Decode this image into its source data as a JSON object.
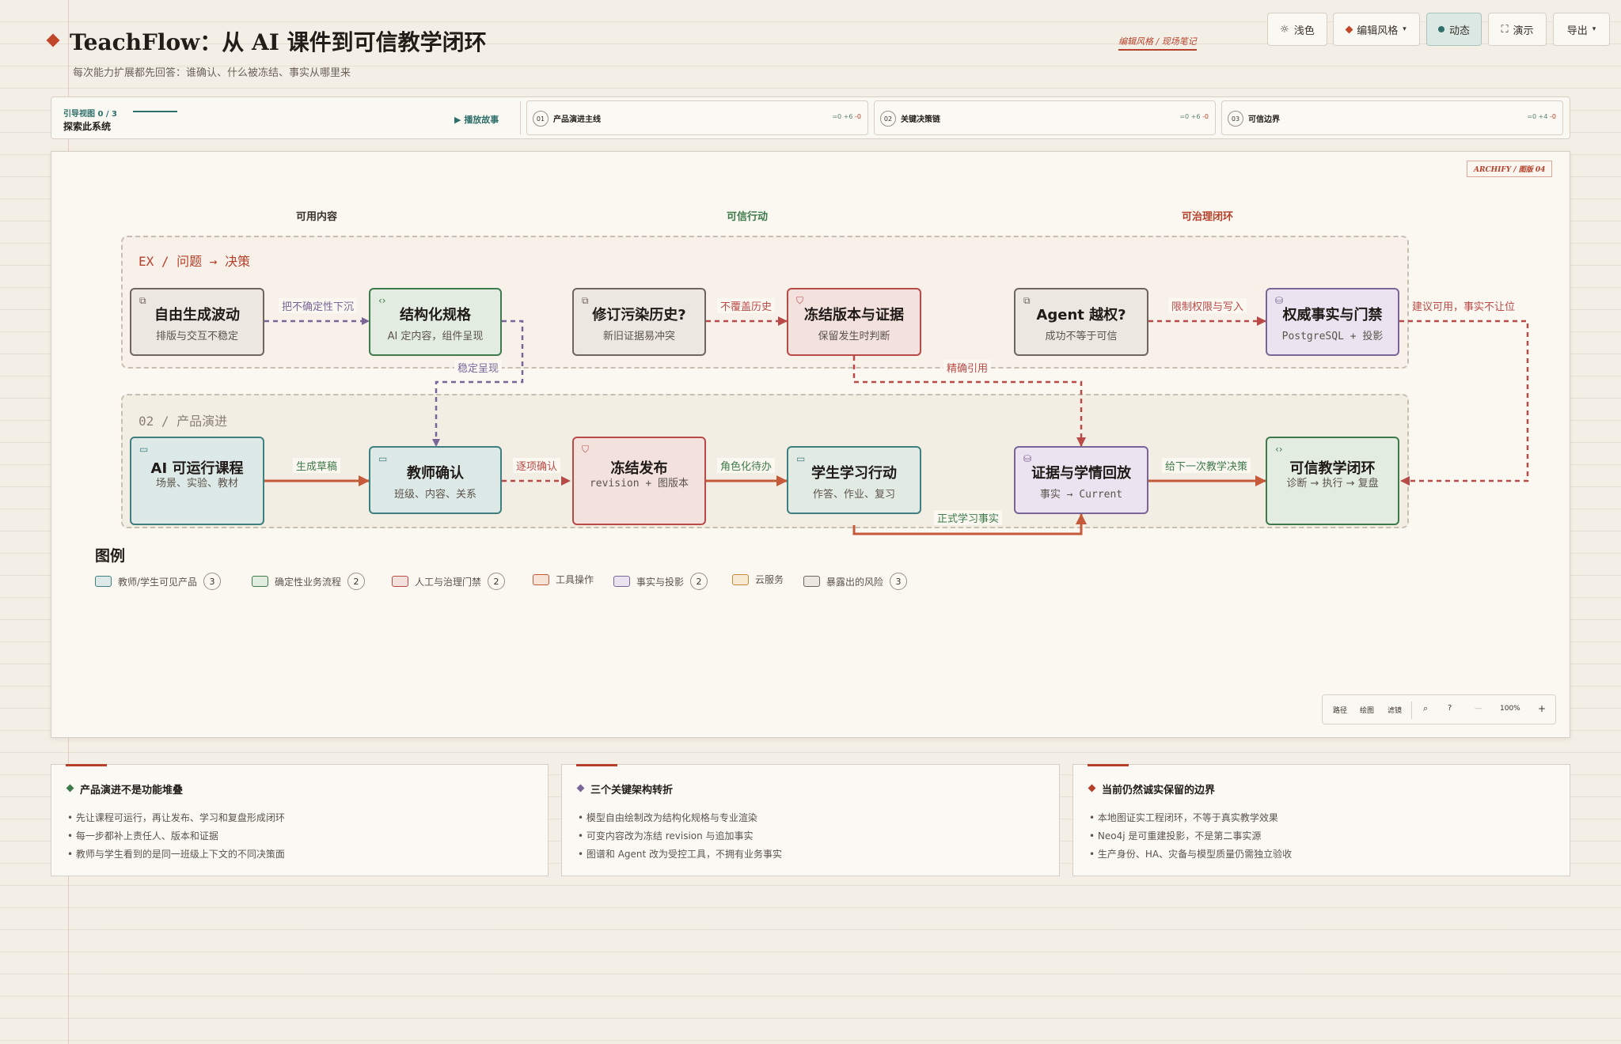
{
  "header": {
    "title": "TeachFlow：从 AI 课件到可信教学闭环",
    "subtitle": "每次能力扩展都先回答：谁确认、什么被冻结、事实从哪里来",
    "style_tag": "编辑风格 / 现场笔记"
  },
  "toolbar": {
    "theme_label": "浅色",
    "style_label": "编辑风格",
    "motion_label": "动态",
    "present_label": "演示",
    "export_label": "导出"
  },
  "guide": {
    "kicker": "引导视图  0 / 3",
    "title": "探索此系统",
    "play_label": "播放故事",
    "stories": [
      {
        "num": "01",
        "title": "产品演进主线",
        "stat_zero": "=0",
        "stat_add": "+6",
        "stat_del": "-0"
      },
      {
        "num": "02",
        "title": "关键决策链",
        "stat_zero": "=0",
        "stat_add": "+6",
        "stat_del": "-0"
      },
      {
        "num": "03",
        "title": "可信边界",
        "stat_zero": "=0",
        "stat_add": "+4",
        "stat_del": "-0"
      }
    ]
  },
  "canvas": {
    "badge": "ARCHIFY / 图版 04",
    "columns": [
      {
        "label": "可用内容",
        "color": "#3a322c"
      },
      {
        "label": "可信行动",
        "color": "#3f7a4c"
      },
      {
        "label": "可治理闭环",
        "color": "#b5412a"
      }
    ],
    "bands": [
      {
        "label": "EX / 问题 → 决策",
        "color": "#b5412a"
      },
      {
        "label": "02 / 产品演进",
        "color": "#8a8078"
      }
    ],
    "nodes": {
      "free_gen": {
        "title": "自由生成波动",
        "sub": "排版与交互不稳定",
        "icon": "external-link-icon",
        "glyph": "⧉"
      },
      "struct_spec": {
        "title": "结构化规格",
        "sub": "AI 定内容，组件呈现",
        "icon": "code-icon",
        "glyph": "‹›"
      },
      "revision": {
        "title": "修订污染历史?",
        "sub": "新旧证据易冲突",
        "icon": "external-link-icon",
        "glyph": "⧉"
      },
      "freeze_ver": {
        "title": "冻结版本与证据",
        "sub": "保留发生时判断",
        "icon": "shield-icon",
        "glyph": "⛉"
      },
      "agent": {
        "title": "Agent 越权?",
        "sub": "成功不等于可信",
        "icon": "external-link-icon",
        "glyph": "⧉"
      },
      "authority": {
        "title": "权威事实与门禁",
        "sub": "PostgreSQL + 投影",
        "icon": "database-icon",
        "glyph": "⛁"
      },
      "ai_course": {
        "title": "AI 可运行课程",
        "sub": "场景、实验、教材",
        "icon": "window-icon",
        "glyph": "▭"
      },
      "teacher": {
        "title": "教师确认",
        "sub": "班级、内容、关系",
        "icon": "window-icon",
        "glyph": "▭"
      },
      "publish": {
        "title": "冻结发布",
        "sub": "revision + 图版本",
        "icon": "shield-icon",
        "glyph": "⛉"
      },
      "student": {
        "title": "学生学习行动",
        "sub": "作答、作业、复习",
        "icon": "window-icon",
        "glyph": "▭"
      },
      "evidence": {
        "title": "证据与学情回放",
        "sub": "事实 → Current",
        "icon": "database-icon",
        "glyph": "⛁"
      },
      "closed_loop": {
        "title": "可信教学闭环",
        "sub": "诊断 → 执行 → 复盘",
        "icon": "code-icon",
        "glyph": "‹›"
      }
    },
    "edge_labels": {
      "sink": "把不确定性下沉",
      "stable": "稳定呈现",
      "no_overwrite": "不覆盖历史",
      "precise_ref": "精确引用",
      "limit": "限制权限与写入",
      "advice": "建议可用，事实不让位",
      "draft": "生成草稿",
      "confirm": "逐项确认",
      "role_todo": "角色化待办",
      "next": "给下一次教学决策",
      "formal_fact": "正式学习事实"
    }
  },
  "legend": {
    "title": "图例",
    "items": [
      {
        "label": "教师/学生可见产品",
        "count": "3",
        "border": "#3f7f80",
        "fill": "#dde9e6"
      },
      {
        "label": "确定性业务流程",
        "count": "2",
        "border": "#3f7a4c",
        "fill": "#e2ece1"
      },
      {
        "label": "人工与治理门禁",
        "count": "2",
        "border": "#b94a48",
        "fill": "#f3e1dd"
      },
      {
        "label": "工具操作",
        "count": "",
        "border": "#c45a3a",
        "fill": "#f6e3d6"
      },
      {
        "label": "事实与投影",
        "count": "2",
        "border": "#7a6598",
        "fill": "#ebe3ef"
      },
      {
        "label": "云服务",
        "count": "",
        "border": "#c08a3a",
        "fill": "#f6ead3"
      },
      {
        "label": "暴露出的风险",
        "count": "3",
        "border": "#6e655e",
        "fill": "#ece7e0"
      }
    ]
  },
  "zoom": {
    "path_label": "路径",
    "lines_label": "绘图",
    "filter_label": "滤镜",
    "zoom_out": "—",
    "zoom_level": "100%",
    "zoom_in": "+"
  },
  "cards": [
    {
      "title": "产品演进不是功能堆叠",
      "diamond_color": "#3f7a4c",
      "items": [
        "先让课程可运行，再让发布、学习和复盘形成闭环",
        "每一步都补上责任人、版本和证据",
        "教师与学生看到的是同一班级上下文的不同决策面"
      ]
    },
    {
      "title": "三个关键架构转折",
      "diamond_color": "#7a6598",
      "items": [
        "模型自由绘制改为结构化规格与专业渲染",
        "可变内容改为冻结 revision 与追加事实",
        "图谱和 Agent 改为受控工具，不拥有业务事实"
      ]
    },
    {
      "title": "当前仍然诚实保留的边界",
      "diamond_color": "#b5412a",
      "items": [
        "本地图证实工程闭环，不等于真实教学效果",
        "Neo4j 是可重建投影，不是第二事实源",
        "生产身份、HA、灾备与模型质量仍需独立验收"
      ]
    }
  ]
}
